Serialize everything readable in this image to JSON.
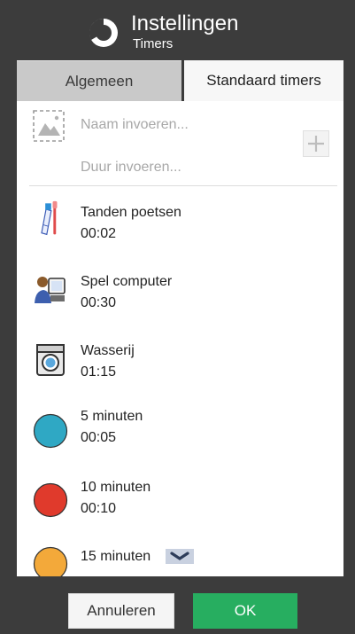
{
  "header": {
    "title": "Instellingen",
    "subtitle": "Timers",
    "logo_icon": "circle-progress-logo"
  },
  "tabs": [
    {
      "label": "Algemeen",
      "selected": false
    },
    {
      "label": "Standaard timers",
      "selected": true
    }
  ],
  "new_timer": {
    "name_placeholder": "Naam invoeren...",
    "duration_placeholder": "Duur invoeren...",
    "photo_icon": "image-placeholder-icon",
    "add_icon": "plus-icon"
  },
  "timers": [
    {
      "name": "Tanden poetsen",
      "duration": "00:02",
      "icon": "toothbrush-icon"
    },
    {
      "name": "Spel computer",
      "duration": "00:30",
      "icon": "computer-user-icon"
    },
    {
      "name": "Wasserij",
      "duration": "01:15",
      "icon": "washing-machine-icon"
    },
    {
      "name": "5 minuten",
      "duration": "00:05",
      "icon": "blue-circle-icon",
      "color": "#2fa8c4"
    },
    {
      "name": "10 minuten",
      "duration": "00:10",
      "icon": "red-circle-icon",
      "color": "#e03a2c"
    },
    {
      "name": "15 minuten",
      "duration": "",
      "icon": "orange-circle-icon",
      "color": "#f3a93a"
    }
  ],
  "footer": {
    "cancel_label": "Annuleren",
    "ok_label": "OK"
  },
  "colors": {
    "background": "#3c3c3c",
    "ok_green": "#27ae60"
  }
}
